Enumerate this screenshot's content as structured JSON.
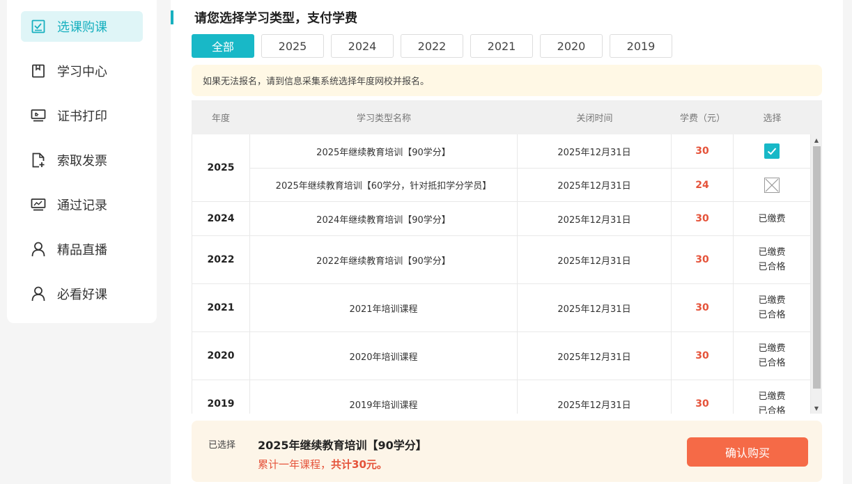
{
  "sidebar": {
    "items": [
      {
        "label": "选课购课",
        "icon": "checklist-icon",
        "active": true
      },
      {
        "label": "学习中心",
        "icon": "bookmark-icon"
      },
      {
        "label": "证书打印",
        "icon": "monitor-icon"
      },
      {
        "label": "索取发票",
        "icon": "document-add-icon"
      },
      {
        "label": "通过记录",
        "icon": "chart-monitor-icon"
      },
      {
        "label": "精品直播",
        "icon": "user-icon"
      },
      {
        "label": "必看好课",
        "icon": "user-icon"
      }
    ]
  },
  "header": {
    "title": "请您选择学习类型，支付学费"
  },
  "year_tabs": [
    "全部",
    "2025",
    "2024",
    "2022",
    "2021",
    "2020",
    "2019"
  ],
  "notice": "如果无法报名，请到信息采集系统选择年度网校并报名。",
  "table": {
    "headers": {
      "year": "年度",
      "name": "学习类型名称",
      "close_time": "关闭时间",
      "fee": "学费（元）",
      "select": "选择"
    },
    "groups": [
      {
        "year": "2025",
        "rows": [
          {
            "name": "2025年继续教育培训【90学分】",
            "close_time": "2025年12月31日",
            "fee": "30",
            "status": "checked"
          },
          {
            "name": "2025年继续教育培训【60学分，针对抵扣学分学员】",
            "close_time": "2025年12月31日",
            "fee": "24",
            "status": "disabled"
          }
        ]
      },
      {
        "year": "2024",
        "rows": [
          {
            "name": "2024年继续教育培训【90学分】",
            "close_time": "2025年12月31日",
            "fee": "30",
            "status1": "已缴费"
          }
        ]
      },
      {
        "year": "2022",
        "rows": [
          {
            "name": "2022年继续教育培训【90学分】",
            "close_time": "2025年12月31日",
            "fee": "30",
            "status1": "已缴费",
            "status2": "已合格"
          }
        ]
      },
      {
        "year": "2021",
        "rows": [
          {
            "name": "2021年培训课程",
            "close_time": "2025年12月31日",
            "fee": "30",
            "status1": "已缴费",
            "status2": "已合格"
          }
        ]
      },
      {
        "year": "2020",
        "rows": [
          {
            "name": "2020年培训课程",
            "close_time": "2025年12月31日",
            "fee": "30",
            "status1": "已缴费",
            "status2": "已合格"
          }
        ]
      },
      {
        "year": "2019",
        "rows": [
          {
            "name": "2019年培训课程",
            "close_time": "2025年12月31日",
            "fee": "30",
            "status1": "已缴费",
            "status2": "已合格"
          }
        ]
      }
    ]
  },
  "footer": {
    "selected_label": "已选择",
    "selected_name": "2025年继续教育培训【90学分】",
    "total_prefix": "累计一年课程，",
    "total_amount": "共计30元。",
    "buy_label": "确认购买"
  },
  "colors": {
    "accent": "#18b8c7",
    "price": "#e5533a",
    "buy": "#f56a47",
    "notice_bg": "#fff8e5"
  }
}
